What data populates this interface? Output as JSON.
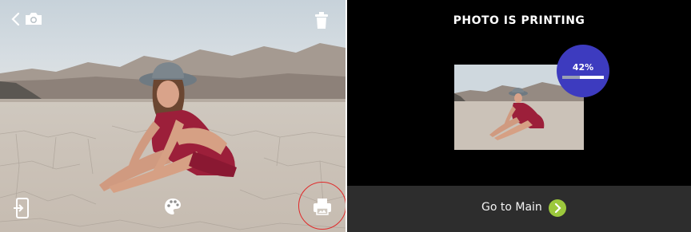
{
  "left_panel": {
    "icons": {
      "back": "chevron-left-icon",
      "camera": "camera-icon",
      "trash": "trash-icon",
      "import": "phone-import-icon",
      "palette": "palette-icon",
      "print": "printer-icon"
    },
    "highlight_color": "#e02a2a"
  },
  "right_panel": {
    "title": "PHOTO IS PRINTING",
    "progress_label": "42%",
    "progress_fraction": 0.42,
    "go_main_label": "Go to Main",
    "colors": {
      "background": "#000000",
      "badge": "#3d3bbf",
      "bottom_bar": "#2d2d2d",
      "arrow": "#9cc83c"
    }
  }
}
